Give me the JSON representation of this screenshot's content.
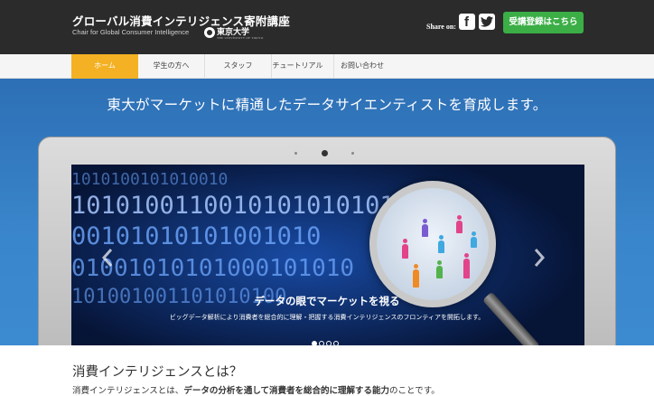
{
  "header": {
    "title": "グローバル消費インテリジェンス寄附講座",
    "subtitle": "Chair for Global Consumer Intelligence",
    "logo_text": "東京大学",
    "logo_en": "THE UNIVERSITY OF TOKYO",
    "share_label": "Share on:",
    "facebook_glyph": "f",
    "cta_label": "受講登録はこちら",
    "cta_color": "#3bae46"
  },
  "nav": {
    "items": [
      {
        "label": "ホーム",
        "active": true
      },
      {
        "label": "学生の方へ",
        "active": false
      },
      {
        "label": "スタッフ",
        "active": false
      },
      {
        "label": "チュートリアル",
        "active": false
      },
      {
        "label": "お問い合わせ",
        "active": false
      }
    ],
    "active_color": "#f3b123"
  },
  "hero": {
    "headline": "東大がマーケットに精通したデータサイエンティストを育成します。",
    "binary_rows": [
      "1010100101010010",
      "10101001100101010101010",
      "00101010101001010",
      "01001010101000101010",
      "101001001101010100"
    ],
    "slide_title": "データの眼でマーケットを視る",
    "slide_text": "ビッグデータ解析により消費者を総合的に理解・把握する消費インテリジェンスのフロンティアを開拓します。",
    "slide_count": 4,
    "active_slide": 1,
    "background_color": "#3a86cc"
  },
  "intro": {
    "title": "消費インテリジェンスとは？",
    "text_before": "消費インテリジェンスとは、",
    "text_bold": "データの分析を通して消費者を総合的に理解する能力",
    "text_after": "のことです。"
  }
}
